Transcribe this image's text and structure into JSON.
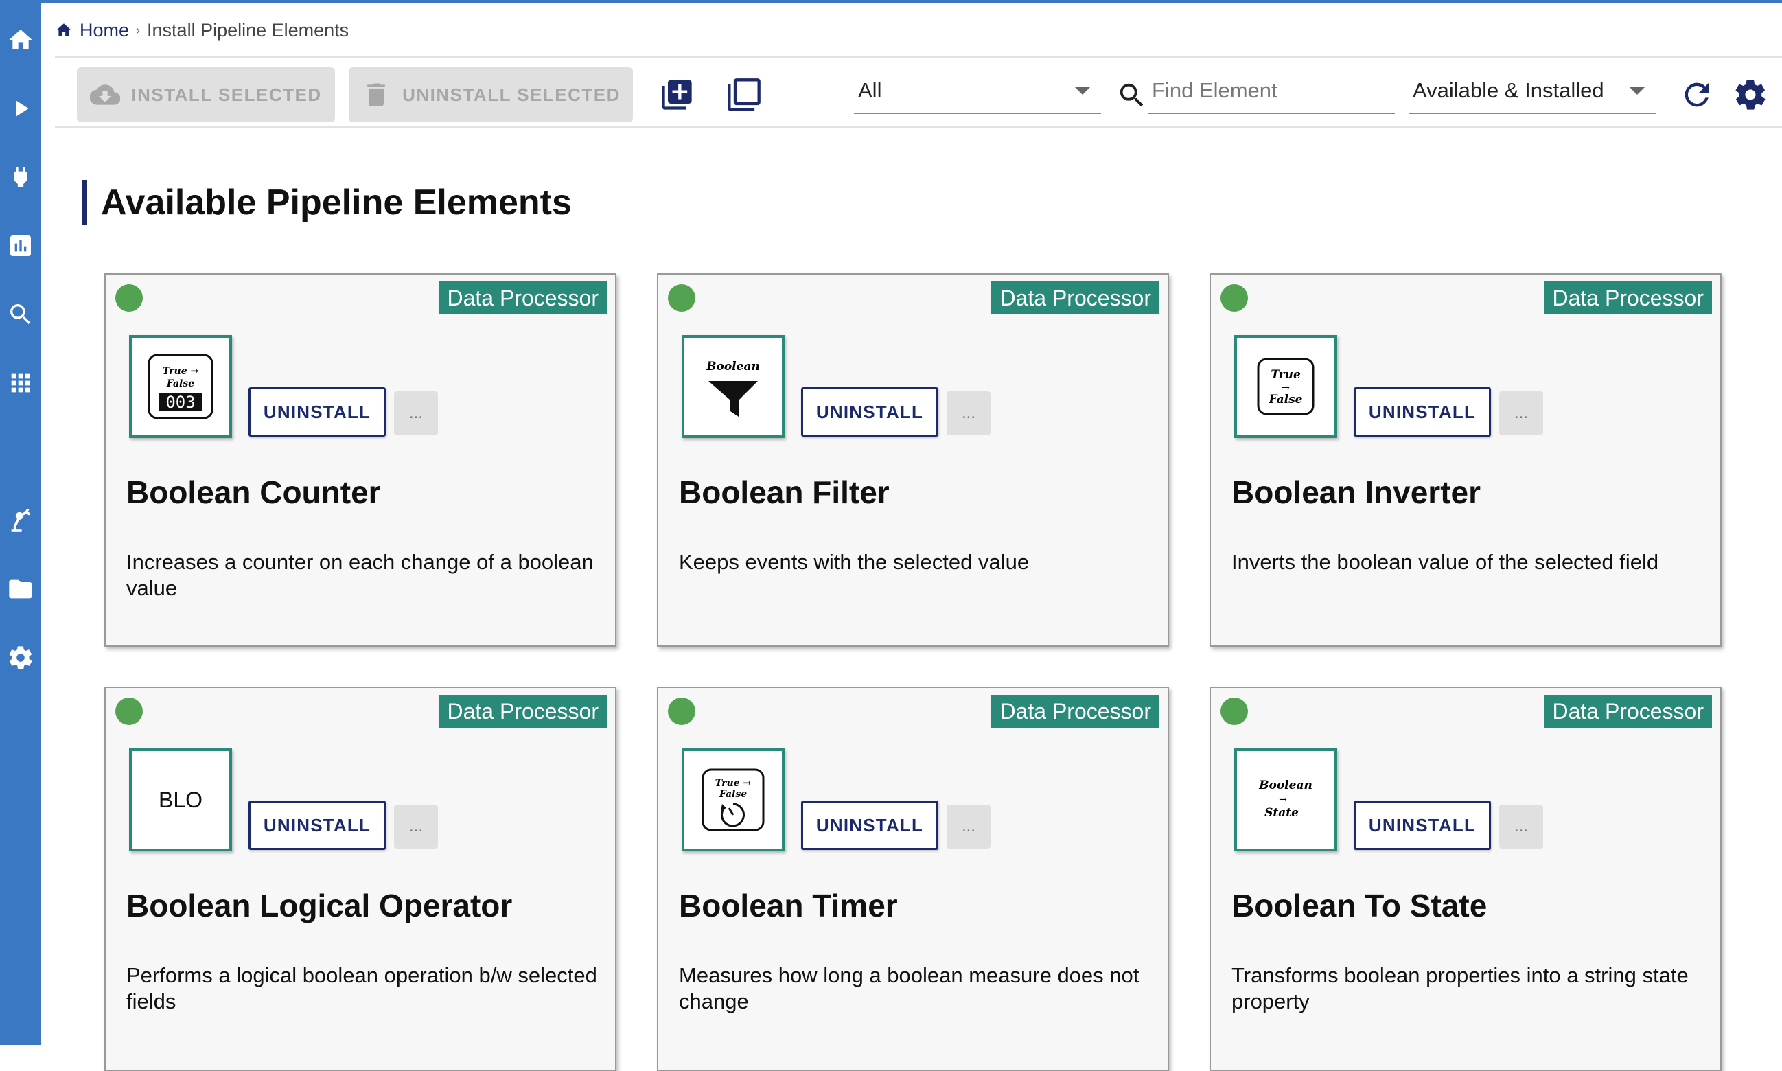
{
  "breadcrumb": {
    "home": "Home",
    "separator": "›",
    "current": "Install Pipeline Elements"
  },
  "toolbar": {
    "install_selected": "INSTALL SELECTED",
    "uninstall_selected": "UNINSTALL SELECTED",
    "filter_type": "All",
    "search_placeholder": "Find Element",
    "filter_status": "Available & Installed"
  },
  "page": {
    "section_title": "Available Pipeline Elements"
  },
  "colors": {
    "sidebar": "#3b78c3",
    "accent": "#1c2a6b",
    "badge": "#2a8a7a",
    "status_dot": "#53a252"
  },
  "sidebar": {
    "items": [
      {
        "icon": "home-icon"
      },
      {
        "icon": "play-icon"
      },
      {
        "icon": "plug-icon"
      },
      {
        "icon": "chart-icon"
      },
      {
        "icon": "search-icon"
      },
      {
        "icon": "apps-grid-icon"
      },
      {
        "icon": "cloud-download-icon",
        "active": true
      },
      {
        "icon": "robot-arm-icon"
      },
      {
        "icon": "folder-icon"
      },
      {
        "icon": "gear-icon"
      }
    ]
  },
  "cards": [
    {
      "badge": "Data Processor",
      "uninstall": "UNINSTALL",
      "more": "...",
      "title": "Boolean Counter",
      "description": "Increases a counter on each change of a boolean value",
      "icon": "boolean-counter-icon",
      "icon_text": [
        "True →",
        "False",
        "003"
      ]
    },
    {
      "badge": "Data Processor",
      "uninstall": "UNINSTALL",
      "more": "...",
      "title": "Boolean Filter",
      "description": "Keeps events with the selected value",
      "icon": "boolean-filter-icon",
      "icon_text": [
        "Boolean"
      ]
    },
    {
      "badge": "Data Processor",
      "uninstall": "UNINSTALL",
      "more": "...",
      "title": "Boolean Inverter",
      "description": "Inverts the boolean value of the selected field",
      "icon": "boolean-inverter-icon",
      "icon_text": [
        "True",
        "→",
        "False"
      ]
    },
    {
      "badge": "Data Processor",
      "uninstall": "UNINSTALL",
      "more": "...",
      "title": "Boolean Logical Operator",
      "description": "Performs a logical boolean operation b/w selected fields",
      "icon": "boolean-logical-operator-icon",
      "icon_text": [
        "BLO"
      ]
    },
    {
      "badge": "Data Processor",
      "uninstall": "UNINSTALL",
      "more": "...",
      "title": "Boolean Timer",
      "description": "Measures how long a boolean measure does not change",
      "icon": "boolean-timer-icon",
      "icon_text": [
        "True →",
        "False"
      ]
    },
    {
      "badge": "Data Processor",
      "uninstall": "UNINSTALL",
      "more": "...",
      "title": "Boolean To State",
      "description": "Transforms boolean properties into a string state property",
      "icon": "boolean-to-state-icon",
      "icon_text": [
        "Boolean",
        "→",
        "State"
      ]
    }
  ]
}
